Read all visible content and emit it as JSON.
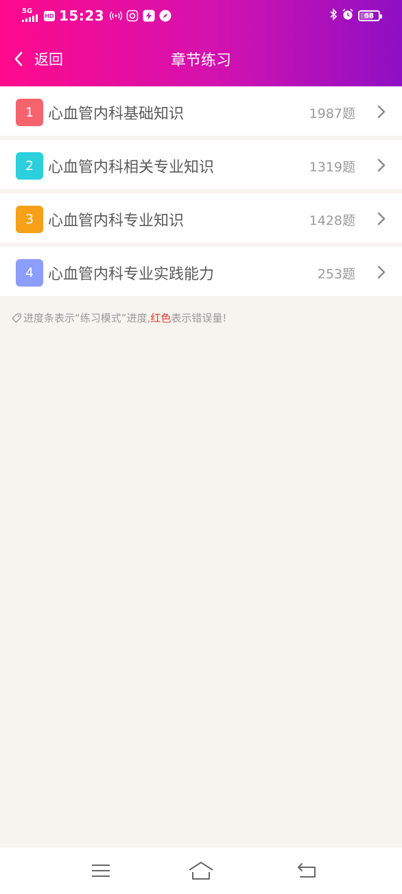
{
  "status_bar": {
    "network": "5G",
    "hd": "HD",
    "time": "15:23",
    "battery": "68",
    "battery_level": 0.68
  },
  "nav": {
    "back_label": "返回",
    "title": "章节练习"
  },
  "chapters": [
    {
      "index": "1",
      "title": "心血管内科基础知识",
      "count": "1987题",
      "color": "#f5636d"
    },
    {
      "index": "2",
      "title": "心血管内科相关专业知识",
      "count": "1319题",
      "color": "#2bd0dc"
    },
    {
      "index": "3",
      "title": "心血管内科专业知识",
      "count": "1428题",
      "color": "#f6a017"
    },
    {
      "index": "4",
      "title": "心血管内科专业实践能力",
      "count": "253题",
      "color": "#8c9dfb"
    }
  ],
  "hint": {
    "before": "进度条表示“练习模式”进度,",
    "red": "红色",
    "after": "表示错误量!"
  },
  "colors": {
    "header_gradient": [
      "#ff0a8c",
      "#d212b0",
      "#8f0fc4"
    ],
    "background": "#f7f3ee",
    "hint_red": "#e53935"
  },
  "icons": {
    "back": "chevron-left-icon",
    "row_arrow": "chevron-right-icon",
    "hint": "tag-icon",
    "menu": "menu-icon",
    "home": "home-icon",
    "return": "return-icon"
  }
}
